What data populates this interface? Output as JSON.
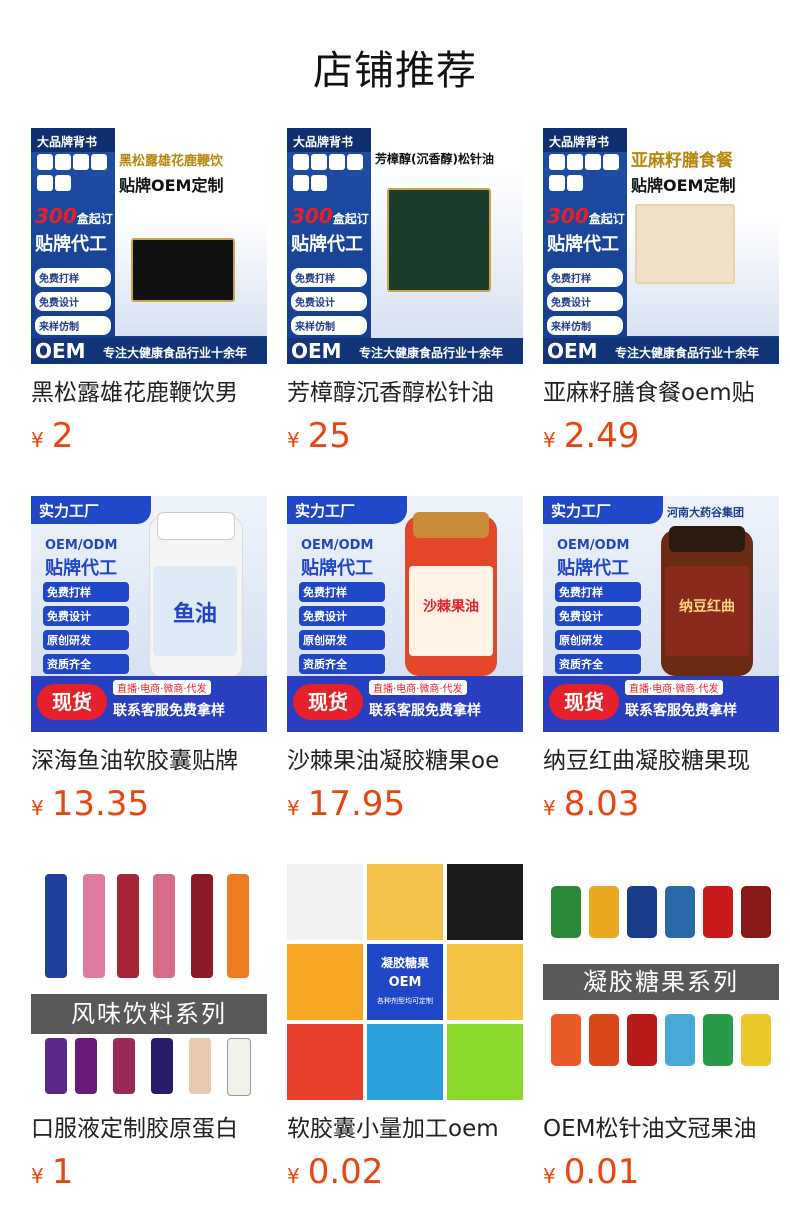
{
  "section": {
    "title": "店铺推荐"
  },
  "currency_symbol": "¥",
  "colors": {
    "price": "#e8450f",
    "poster_blue": "#1f47c8",
    "poster_navy": "#163d8a"
  },
  "products": [
    {
      "name": "黑松露雄花鹿鞭饮男",
      "price": "2",
      "poster": {
        "tag": "大品牌背书",
        "headline": "黑松露雄花鹿鞭饮",
        "headline2": "贴牌OEM定制",
        "big": "300",
        "big_suffix": "盒起订",
        "big2": "贴牌代工",
        "pills": [
          "免费打样",
          "免费设计",
          "来样仿制"
        ],
        "oem": "OEM",
        "slogan": "专注大健康食品行业十余年"
      }
    },
    {
      "name": "芳樟醇沉香醇松针油",
      "price": "25",
      "poster": {
        "tag": "大品牌背书",
        "headline": "芳樟醇(沉香醇)松针油",
        "headline2": "",
        "big": "300",
        "big_suffix": "盒起订",
        "big2": "贴牌代工",
        "pills": [
          "免费打样",
          "免费设计",
          "来样仿制"
        ],
        "oem": "OEM",
        "slogan": "专注大健康食品行业十余年"
      }
    },
    {
      "name": "亚麻籽膳食餐oem贴",
      "price": "2.49",
      "poster": {
        "tag": "大品牌背书",
        "headline": "亚麻籽膳食餐",
        "headline2": "贴牌OEM定制",
        "big": "300",
        "big_suffix": "盒起订",
        "big2": "贴牌代工",
        "pills": [
          "免费打样",
          "免费设计",
          "来样仿制"
        ],
        "oem": "OEM",
        "slogan": "专注大健康食品行业十余年"
      }
    },
    {
      "name": "深海鱼油软胶囊贴牌",
      "price": "13.35",
      "poster": {
        "tag": "实力工厂",
        "corner": "",
        "line1": "OEM/ODM",
        "line2": "贴牌代工",
        "checks": [
          "免费打样",
          "免费设计",
          "原创研发",
          "资质齐全"
        ],
        "label": "鱼油",
        "stock": "现货",
        "channels": "直播·电商·微商·代发",
        "contact": "联系客服免费拿样"
      }
    },
    {
      "name": "沙棘果油凝胶糖果oe",
      "price": "17.95",
      "poster": {
        "tag": "实力工厂",
        "corner": "",
        "line1": "OEM/ODM",
        "line2": "贴牌代工",
        "checks": [
          "免费打样",
          "免费设计",
          "原创研发",
          "资质齐全"
        ],
        "label": "沙棘果油",
        "stock": "现货",
        "channels": "直播·电商·微商·代发",
        "contact": "联系客服免费拿样"
      }
    },
    {
      "name": "纳豆红曲凝胶糖果现",
      "price": "8.03",
      "poster": {
        "tag": "实力工厂",
        "corner": "河南大药谷集团",
        "line1": "OEM/ODM",
        "line2": "贴牌代工",
        "checks": [
          "免费打样",
          "免费设计",
          "原创研发",
          "资质齐全"
        ],
        "label": "纳豆红曲",
        "stock": "现货",
        "channels": "直播·电商·微商·代发",
        "contact": "联系客服免费拿样"
      }
    },
    {
      "name": "口服液定制胶原蛋白",
      "price": "1",
      "poster": {
        "band": "风味饮料系列"
      }
    },
    {
      "name": "软胶囊小量加工oem",
      "price": "0.02",
      "poster": {
        "c1": "凝胶糖果",
        "c2": "OEM",
        "c3": "各种剂型均可定制"
      }
    },
    {
      "name": "OEM松针油文冠果油",
      "price": "0.01",
      "poster": {
        "band": "凝胶糖果系列"
      }
    }
  ]
}
